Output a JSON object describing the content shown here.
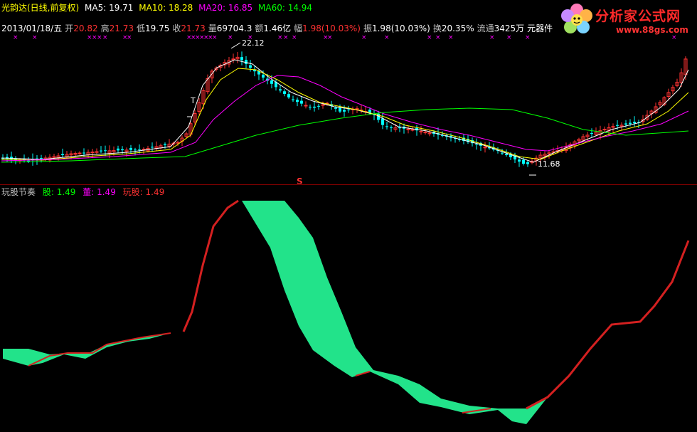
{
  "header": {
    "stock": "光韵达(日线,前复权)",
    "ma5": "MA5: 19.71",
    "ma10": "MA10: 18.28",
    "ma20": "MA20: 16.85",
    "ma60": "MA60: 14.94",
    "date": "2013/01/18/五",
    "open_label": "开",
    "open": "20.82",
    "high_label": "高",
    "high": "21.73",
    "low_label": "低",
    "low": "19.75",
    "close_label": "收",
    "close": "21.73",
    "vol_label": "量",
    "vol": "69704.3",
    "amt_label": "额",
    "amt": "1.46亿",
    "chg_label": "幅",
    "chg": "1.98(10.03%)",
    "amp_label": "振",
    "amp": "1.98(10.03%)",
    "turn_label": "换",
    "turn": "20.35%",
    "float_label": "流通",
    "float": "3425万",
    "unit": "元器件"
  },
  "logo": {
    "title": "分析家公式网",
    "url": "www.88gs.com"
  },
  "price_annotations": {
    "high_marker": "22.12",
    "low_marker": "11.68",
    "t_marker": "T",
    "s_marker": "S"
  },
  "indicator": {
    "name": "玩股节奏",
    "a_label": "股: 1.49",
    "b_label": "董: 1.49",
    "c_label": "玩股: 1.49"
  },
  "colors": {
    "up": "#ff3232",
    "down": "#00ffff",
    "ma5": "#ffffff",
    "ma10": "#ffff00",
    "ma20": "#ff00ff",
    "ma60": "#00ff00",
    "band_fill": "#22e38a",
    "band_edge": "#d42020"
  }
}
